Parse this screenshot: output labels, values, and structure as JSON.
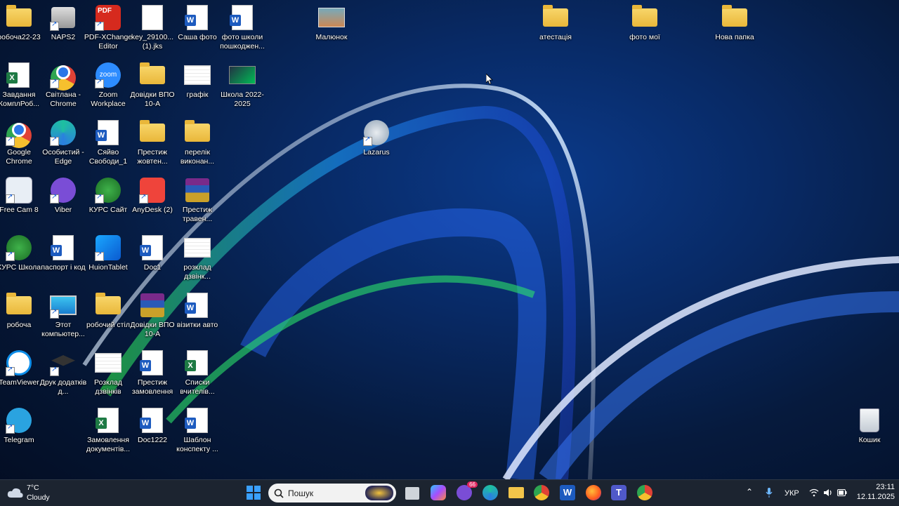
{
  "desktop": {
    "icons": [
      {
        "label": "робоча22-23",
        "type": "folder"
      },
      {
        "label": "NAPS2",
        "type": "naps2"
      },
      {
        "label": "PDF-XChange Editor",
        "type": "pdf"
      },
      {
        "label": "key_29100...(1).jks",
        "type": "blank"
      },
      {
        "label": "Саша фото",
        "type": "word"
      },
      {
        "label": "фото школи пошкоджен...",
        "type": "word"
      },
      {
        "label": "Малюнок",
        "type": "image"
      },
      {
        "label": "атестація",
        "type": "folder"
      },
      {
        "label": "фото мої",
        "type": "folder"
      },
      {
        "label": "Нова папка",
        "type": "folder"
      },
      {
        "label": "Завдання КомплРоб...",
        "type": "excel"
      },
      {
        "label": "Світлана - Chrome",
        "type": "chrome"
      },
      {
        "label": "Zoom Workplace",
        "type": "zoom"
      },
      {
        "label": "Довідки ВПО 10-А",
        "type": "folder"
      },
      {
        "label": "графік",
        "type": "sheet"
      },
      {
        "label": "Школа 2022-2025",
        "type": "ppt"
      },
      {
        "label": "Google Chrome",
        "type": "chrome"
      },
      {
        "label": "Особистий - Edge",
        "type": "edge"
      },
      {
        "label": "Сяйво Свободи_1",
        "type": "word"
      },
      {
        "label": "Престиж жовтен...",
        "type": "folder"
      },
      {
        "label": "перелік виконан...",
        "type": "folder"
      },
      {
        "label": "Lazarus",
        "type": "lazarus"
      },
      {
        "label": "Free Cam 8",
        "type": "freecam"
      },
      {
        "label": "Viber",
        "type": "viber"
      },
      {
        "label": "КУРС Сайт",
        "type": "kurs"
      },
      {
        "label": "AnyDesk (2)",
        "type": "anydesk"
      },
      {
        "label": "Престиж травен...",
        "type": "rar"
      },
      {
        "label": "КУРС Школа",
        "type": "kurs"
      },
      {
        "label": "паспорт і код",
        "type": "word"
      },
      {
        "label": "HuionTablet",
        "type": "huion"
      },
      {
        "label": "Doc1",
        "type": "word"
      },
      {
        "label": "розклад дзвінк...",
        "type": "sheet"
      },
      {
        "label": "робоча",
        "type": "folder"
      },
      {
        "label": "Этот компьютер...",
        "type": "pc"
      },
      {
        "label": "робочий стіл",
        "type": "folder"
      },
      {
        "label": "Довідки ВПО 10-А",
        "type": "rar"
      },
      {
        "label": "візитки авто",
        "type": "word"
      },
      {
        "label": "TeamViewer",
        "type": "teamviewer"
      },
      {
        "label": "Друк додатків д...",
        "type": "cap"
      },
      {
        "label": "Розклад дзвінків",
        "type": "sheet"
      },
      {
        "label": "Престиж замовлення",
        "type": "word"
      },
      {
        "label": "Списки вчителів...",
        "type": "excel"
      },
      {
        "label": "Telegram",
        "type": "telegram"
      },
      {
        "label": "Замовлення документів...",
        "type": "excel"
      },
      {
        "label": "Doc1222",
        "type": "word"
      },
      {
        "label": "Шаблон конспекту ...",
        "type": "word"
      },
      {
        "label": "Кошик",
        "type": "recycle"
      }
    ]
  },
  "taskbar": {
    "weather_temp": "7°C",
    "weather_desc": "Cloudy",
    "search_placeholder": "Пошук",
    "viber_badge": "66",
    "language": "УКР",
    "time": "23:11",
    "date": "12.11.2025"
  }
}
